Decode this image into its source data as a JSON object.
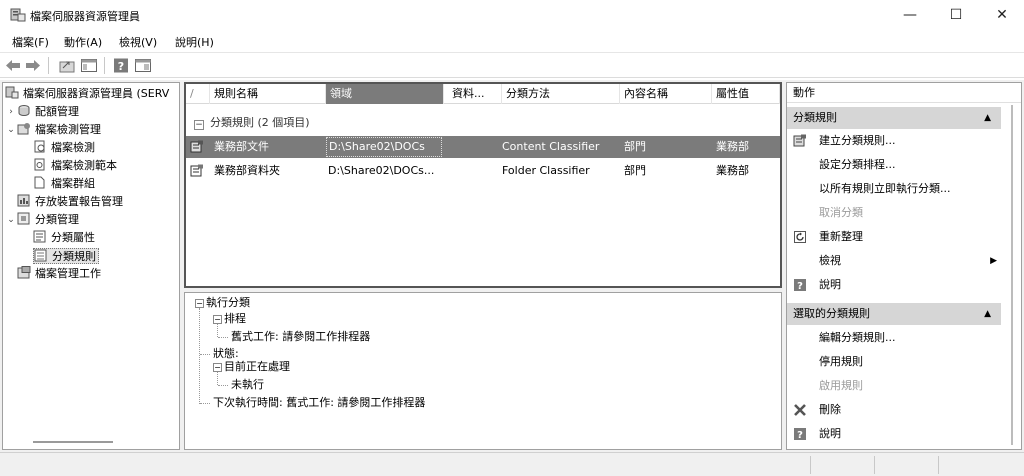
{
  "window": {
    "title": "檔案伺服器資源管理員",
    "minimize_glyph": "—",
    "maximize_glyph": "☐",
    "close_glyph": "✕"
  },
  "menu": [
    "檔案(F)",
    "動作(A)",
    "檢視(V)",
    "說明(H)"
  ],
  "tree": {
    "root": "檔案伺服器資源管理員 (SERV",
    "items": {
      "quota": "配額管理",
      "screening": "檔案檢測管理",
      "screens": "檔案檢測",
      "templates": "檔案檢測範本",
      "groups": "檔案群組",
      "reports": "存放裝置報告管理",
      "classification": "分類管理",
      "properties": "分類屬性",
      "rules": "分類規則",
      "tasks": "檔案管理工作"
    }
  },
  "list": {
    "columns": [
      "/",
      "規則名稱",
      "領域",
      "資料...",
      "分類方法",
      "內容名稱",
      "屬性值"
    ],
    "group_label": "分類規則 (2 個項目)",
    "rows": [
      {
        "name": "業務部文件",
        "scope": "D:\\Share02\\DOCs",
        "data": "",
        "method": "Content Classifier",
        "property": "部門",
        "value": "業務部"
      },
      {
        "name": "業務部資料夾",
        "scope": "D:\\Share02\\DOCs...",
        "data": "",
        "method": "Folder Classifier",
        "property": "部門",
        "value": "業務部"
      }
    ]
  },
  "detail": {
    "run": "執行分類",
    "schedule": "排程",
    "schedule_value": "舊式工作: 請參閱工作排程器",
    "status": "狀態:",
    "running": "目前正在處理",
    "not_running": "未執行",
    "next_run": "下次執行時間: 舊式工作: 請參閱工作排程器"
  },
  "actions": {
    "title": "動作",
    "section1": "分類規則",
    "section1_items": [
      "建立分類規則...",
      "設定分類排程...",
      "以所有規則立即執行分類...",
      "取消分類",
      "重新整理",
      "檢視",
      "說明"
    ],
    "section2": "選取的分類規則",
    "section2_items": [
      "編輯分類規則...",
      "停用規則",
      "啟用規則",
      "刪除",
      "說明"
    ]
  },
  "colors": {
    "selection": "#7b7b7b",
    "section_bg": "#d6d6d6",
    "disabled": "#9b9b9b"
  }
}
